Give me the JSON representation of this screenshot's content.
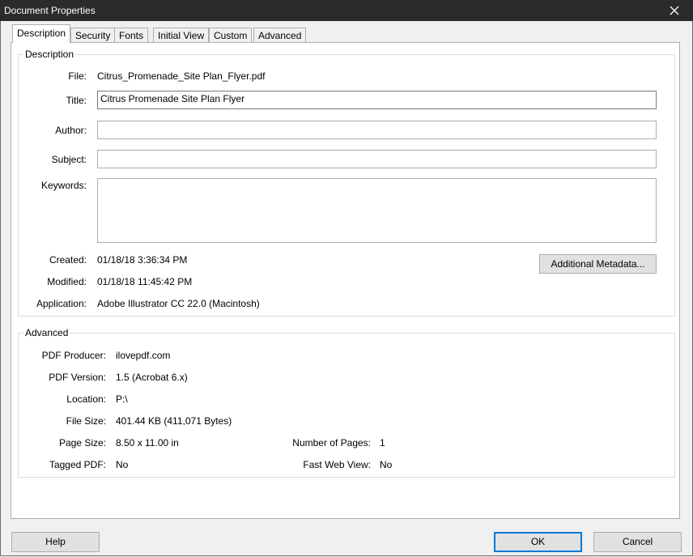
{
  "window": {
    "title": "Document Properties"
  },
  "tabs": [
    "Description",
    "Security",
    "Fonts",
    "Initial View",
    "Custom",
    "Advanced"
  ],
  "description": {
    "group_title": "Description",
    "file_label": "File:",
    "file_value": "Citrus_Promenade_Site Plan_Flyer.pdf",
    "title_label": "Title:",
    "title_value": "Citrus Promenade Site Plan Flyer",
    "author_label": "Author:",
    "author_value": "",
    "subject_label": "Subject:",
    "subject_value": "",
    "keywords_label": "Keywords:",
    "keywords_value": "",
    "created_label": "Created:",
    "created_value": "01/18/18 3:36:34 PM",
    "modified_label": "Modified:",
    "modified_value": "01/18/18 11:45:42 PM",
    "application_label": "Application:",
    "application_value": "Adobe Illustrator CC 22.0 (Macintosh)",
    "metadata_button": "Additional Metadata..."
  },
  "advanced": {
    "group_title": "Advanced",
    "producer_label": "PDF Producer:",
    "producer_value": "ilovepdf.com",
    "version_label": "PDF Version:",
    "version_value": "1.5 (Acrobat 6.x)",
    "location_label": "Location:",
    "location_value": "P:\\",
    "filesize_label": "File Size:",
    "filesize_value": "401.44 KB (411,071 Bytes)",
    "pagesize_label": "Page Size:",
    "pagesize_value": "8.50 x 11.00 in",
    "numpages_label": "Number of Pages:",
    "numpages_value": "1",
    "tagged_label": "Tagged PDF:",
    "tagged_value": "No",
    "fastweb_label": "Fast Web View:",
    "fastweb_value": "No"
  },
  "buttons": {
    "help": "Help",
    "ok": "OK",
    "cancel": "Cancel"
  },
  "colors": {
    "titlebar": "#2b2b2b",
    "accent": "#0078d7"
  }
}
